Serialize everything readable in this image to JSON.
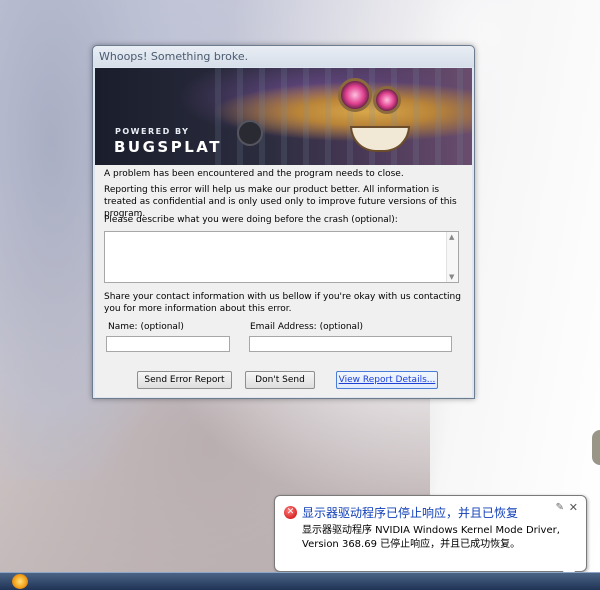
{
  "dialog": {
    "title": "Whoops! Something broke.",
    "banner": {
      "powered_by": "POWERED BY",
      "brand": "BUGSPLAT"
    },
    "message1": "A problem has been encountered and the program needs to close.",
    "message2": "Reporting this error will help us make our product better. All information is treated as confidential and is only used only to improve future versions of this program.",
    "describe_label": "Please describe what you were doing before the crash (optional):",
    "describe_value": "",
    "contact_info": "Share your contact information with us bellow if you're okay with us contacting you for more information about this error.",
    "name_label": "Name: (optional)",
    "name_value": "",
    "email_label": "Email Address: (optional)",
    "email_value": "",
    "buttons": {
      "send": "Send Error Report",
      "dont_send": "Don't Send",
      "view_details": "View Report Details..."
    }
  },
  "notification": {
    "title": "显示器驱动程序已停止响应，并且已恢复",
    "text": "显示器驱动程序 NVIDIA Windows Kernel Mode Driver, Version 368.69  已停止响应，并且已成功恢复。",
    "icon": "error-icon"
  }
}
